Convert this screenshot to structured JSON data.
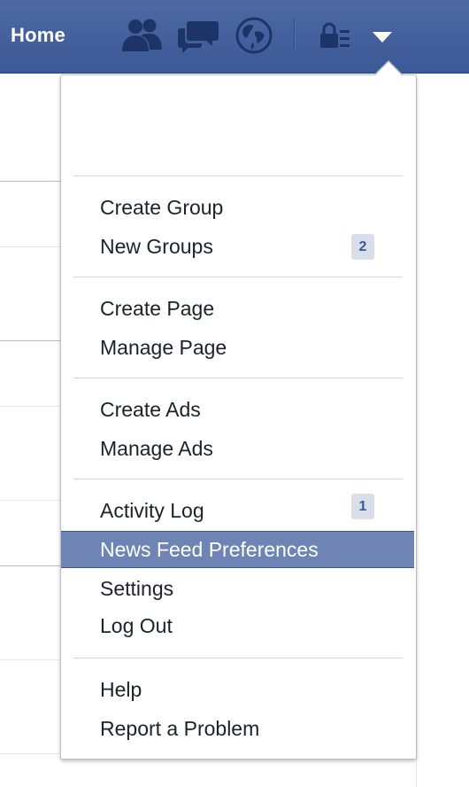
{
  "header": {
    "home_label": "Home",
    "icons": [
      "friend-requests-icon",
      "messages-icon",
      "notifications-globe-icon",
      "privacy-shortcuts-icon",
      "account-menu-caret-icon"
    ],
    "bar_color": "#3b5998"
  },
  "menu": {
    "groups": [
      {
        "items": [
          {
            "label": "Create Group"
          },
          {
            "label": "New Groups",
            "badge": "2"
          }
        ]
      },
      {
        "items": [
          {
            "label": "Create Page"
          },
          {
            "label": "Manage Page"
          }
        ]
      },
      {
        "items": [
          {
            "label": "Create Ads"
          },
          {
            "label": "Manage Ads"
          }
        ]
      },
      {
        "items": [
          {
            "label": "Activity Log",
            "badge": "1"
          },
          {
            "label": "News Feed Preferences",
            "highlighted": true
          },
          {
            "label": "Settings"
          },
          {
            "label": "Log Out"
          }
        ]
      },
      {
        "items": [
          {
            "label": "Help"
          },
          {
            "label": "Report a Problem"
          }
        ]
      }
    ],
    "highlight_color": "#6d84b4"
  }
}
